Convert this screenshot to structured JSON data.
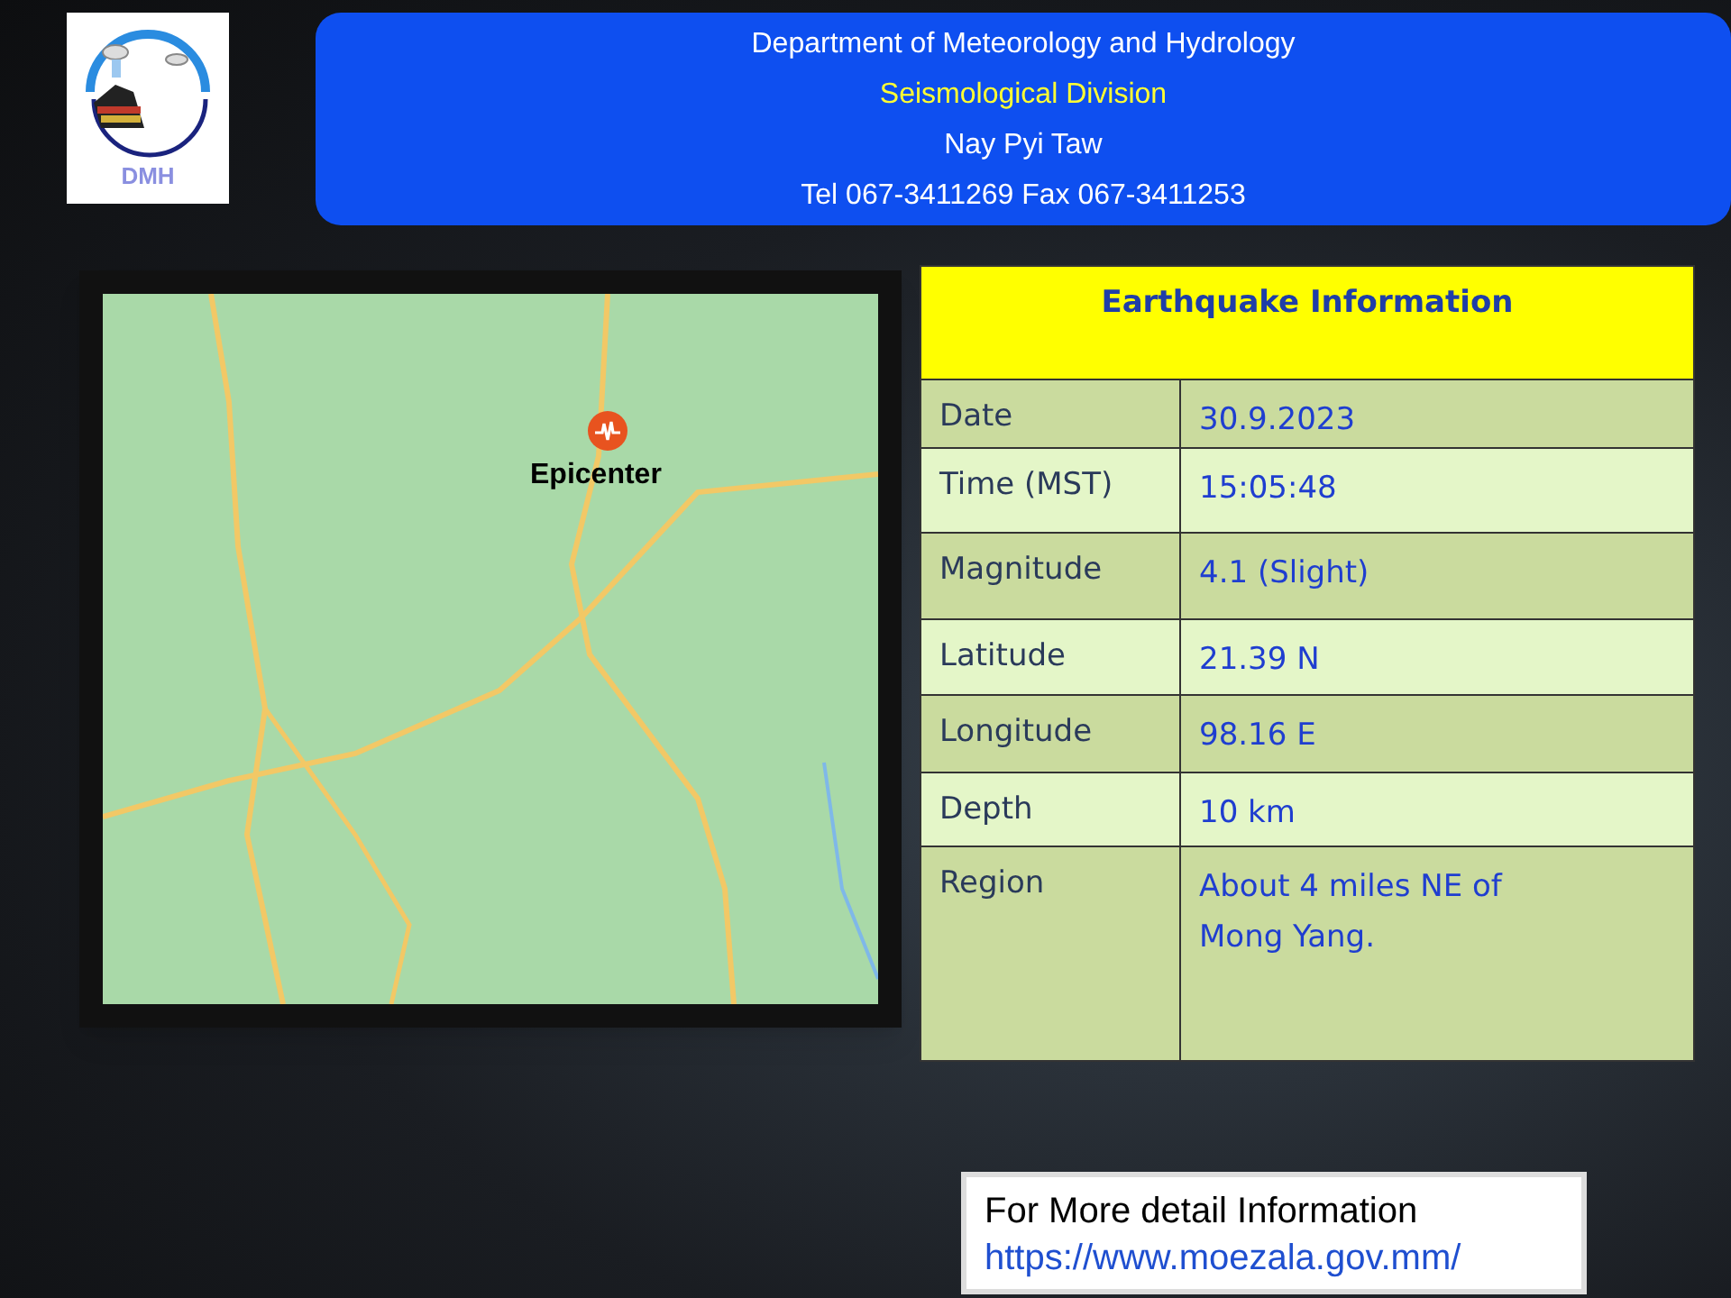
{
  "logo": {
    "text": "DMH"
  },
  "header": {
    "lines": [
      {
        "text": "Department of Meteorology and Hydrology",
        "color": "#ffffff"
      },
      {
        "text": "Seismological Division",
        "color": "#ffff33"
      },
      {
        "text": "Nay Pyi Taw",
        "color": "#ffffff"
      },
      {
        "text": "Tel 067-3411269 Fax 067-3411253",
        "color": "#ffffff"
      }
    ]
  },
  "map": {
    "epicenter_label": "Epicenter"
  },
  "info_table": {
    "title": "Earthquake Information",
    "rows": [
      {
        "label": "Date",
        "value": "30.9.2023"
      },
      {
        "label": "Time (MST)",
        "value": "15:05:48"
      },
      {
        "label": "Magnitude",
        "value": "4.1 (Slight)"
      },
      {
        "label": "Latitude",
        "value": "21.39 N"
      },
      {
        "label": "Longitude",
        "value": "98.16 E"
      },
      {
        "label": "Depth",
        "value": "10 km"
      },
      {
        "label": "Region",
        "value": "About 4 miles NE of Mong Yang."
      }
    ]
  },
  "footer": {
    "text": "For More detail Information",
    "link": "https://www.moezala.gov.mm/"
  }
}
